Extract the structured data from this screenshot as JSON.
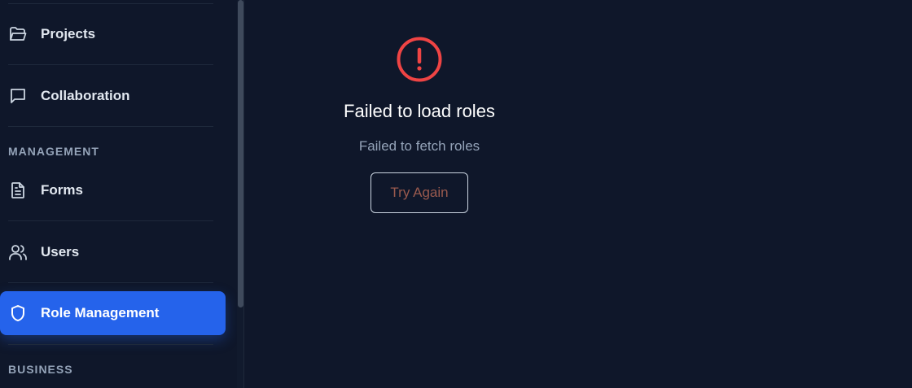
{
  "sidebar": {
    "items": [
      {
        "label": "Projects",
        "icon": "folder-open-icon"
      },
      {
        "label": "Collaboration",
        "icon": "message-square-icon"
      },
      {
        "label": "Forms",
        "icon": "file-text-icon"
      },
      {
        "label": "Users",
        "icon": "users-icon"
      },
      {
        "label": "Role Management",
        "icon": "shield-icon",
        "active": true
      }
    ],
    "sections": {
      "management": "MANAGEMENT",
      "business": "BUSINESS"
    }
  },
  "main": {
    "error": {
      "icon": "alert-circle-icon",
      "title": "Failed to load roles",
      "description": "Failed to fetch roles",
      "retry_label": "Try Again"
    }
  },
  "colors": {
    "background": "#0f172a",
    "accent": "#2563eb",
    "error": "#ef4444",
    "muted": "#94a3b8"
  }
}
